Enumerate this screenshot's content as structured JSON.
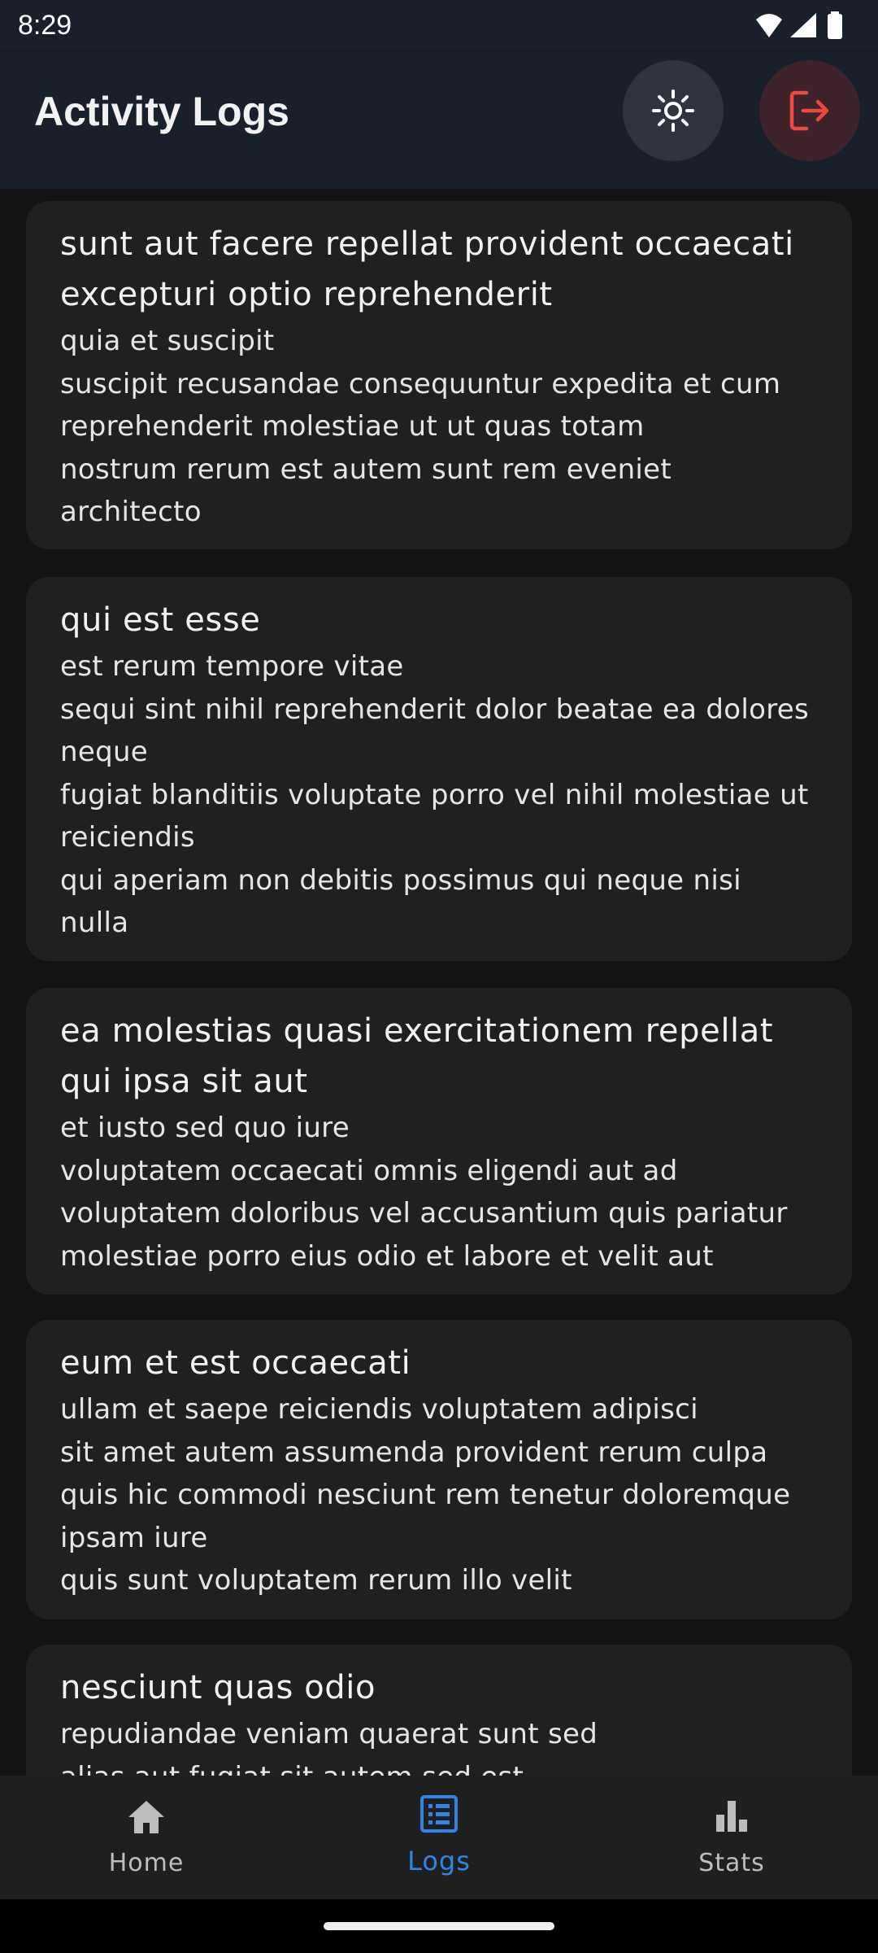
{
  "status_bar": {
    "time": "8:29",
    "icons": [
      "wifi-icon",
      "signal-icon",
      "battery-icon"
    ]
  },
  "app_bar": {
    "title": "Activity Logs",
    "actions": [
      {
        "name": "theme-toggle",
        "icon": "sun-icon",
        "color": "#ffffff"
      },
      {
        "name": "logout",
        "icon": "logout-icon",
        "color": "#f0483e"
      }
    ]
  },
  "logs": [
    {
      "title": "sunt aut facere repellat provident occaecati excepturi optio reprehenderit",
      "body": "quia et suscipit\nsuscipit recusandae consequuntur expedita et cum reprehenderit molestiae ut ut quas totam\nnostrum rerum est autem sunt rem eveniet architecto"
    },
    {
      "title": "qui est esse",
      "body": "est rerum tempore vitae\nsequi sint nihil reprehenderit dolor beatae ea dolores neque\nfugiat blanditiis voluptate porro vel nihil molestiae ut reiciendis\nqui aperiam non debitis possimus qui neque nisi nulla"
    },
    {
      "title": "ea molestias quasi exercitationem repellat qui ipsa sit aut",
      "body": "et iusto sed quo iure\nvoluptatem occaecati omnis eligendi aut ad\nvoluptatem doloribus vel accusantium quis pariatur\nmolestiae porro eius odio et labore et velit aut"
    },
    {
      "title": "eum et est occaecati",
      "body": "ullam et saepe reiciendis voluptatem adipisci\nsit amet autem assumenda provident rerum culpa\nquis hic commodi nesciunt rem tenetur doloremque ipsam iure\nquis sunt voluptatem rerum illo velit"
    },
    {
      "title": "nesciunt quas odio",
      "body": "repudiandae veniam quaerat sunt sed\nalias aut fugiat sit autem sed est"
    }
  ],
  "bottom_nav": {
    "items": [
      {
        "label": "Home",
        "icon": "home-icon",
        "active": false
      },
      {
        "label": "Logs",
        "icon": "list-icon",
        "active": true
      },
      {
        "label": "Stats",
        "icon": "bar-chart-icon",
        "active": false
      }
    ],
    "active_color": "#2f84e6",
    "inactive_color": "#bdbdbd"
  }
}
